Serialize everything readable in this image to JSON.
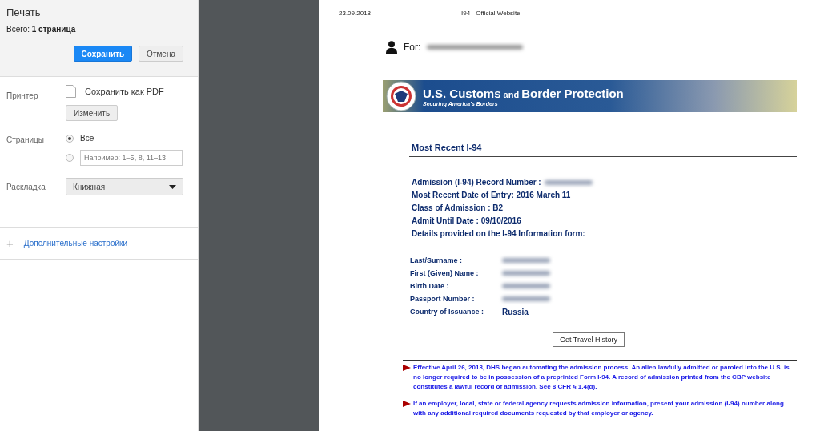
{
  "print_panel": {
    "title": "Печать",
    "total": "Всего: **1 страница**",
    "buttons": [
      {
        "label": "Сохранить",
        "kind": "primary"
      },
      {
        "label": "Отмена",
        "kind": "secondary"
      }
    ],
    "printer": {
      "label": "Принтер",
      "destination": "Сохранить как PDF",
      "change_button": "Изменить"
    },
    "pages": {
      "label": "Страницы",
      "options": [
        {
          "kind": "all",
          "label": "Все",
          "selected": true
        },
        {
          "kind": "custom",
          "placeholder": "Например: 1–5, 8, 11–13",
          "selected": false
        }
      ]
    },
    "layout": {
      "label": "Раскладка",
      "value": "Книжная"
    },
    "more_settings": {
      "icon": "+",
      "label": "Дополнительные настройки"
    }
  },
  "preview": {
    "date": "23.09.2018",
    "page_title": "I94 - Official Website",
    "for_label": "For:",
    "banner": {
      "title_parts": [
        "U.S. Customs",
        " and ",
        "Border Protection"
      ],
      "tagline": "Securing America's Borders"
    },
    "heading": "Most Recent I-94",
    "details": [
      {
        "text": "Admission (I-94) Record Number :",
        "redacted": true
      },
      {
        "text": "Most Recent Date of Entry: 2016 March 11",
        "redacted": false
      },
      {
        "text": "Class of Admission : B2",
        "redacted": false
      },
      {
        "text": "Admit Until Date : 09/10/2016",
        "redacted": false
      },
      {
        "text": "Details provided on the I-94 Information form:",
        "redacted": false
      }
    ],
    "form_fields": [
      {
        "label": "Last/Surname :",
        "redacted": true
      },
      {
        "label": "First (Given) Name :",
        "redacted": true
      },
      {
        "label": "Birth Date :",
        "redacted": true
      },
      {
        "label": "Passport Number :",
        "redacted": true
      },
      {
        "label": "Country of Issuance :",
        "value": "Russia",
        "redacted": false
      }
    ],
    "travel_button": "Get Travel History",
    "notes": [
      "Effective April 26, 2013, DHS began automating the admission process. An alien lawfully admitted or paroled into the U.S. is no longer required to be in possession of a preprinted Form I-94. A record of admission printed from the CBP website constitutes a lawful record of admission. See 8 CFR § 1.4(d).",
      "If an employer, local, state or federal agency requests admission information, present your admission (I-94) number along with any additional required documents requested by that employer or agency."
    ]
  }
}
